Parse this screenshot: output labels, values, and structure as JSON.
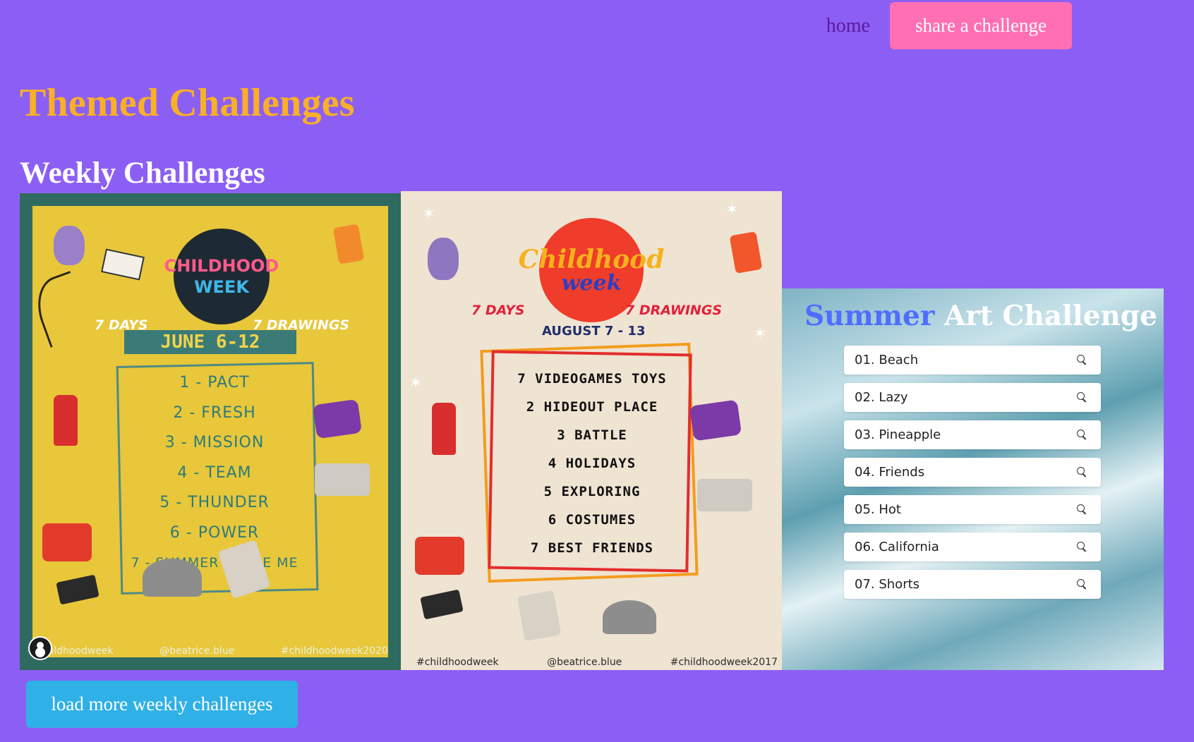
{
  "nav": {
    "home_label": "home",
    "share_label": "share a challenge"
  },
  "page_title": "Themed Challenges",
  "section_title": "Weekly Challenges",
  "cards": [
    {
      "badge_line1": "CHILDHOOD",
      "badge_line2": "WEEK",
      "days": "7 DAYS",
      "drawings": "7 DRAWINGS",
      "date": "JUNE 6-12",
      "items": [
        "1 - PACT",
        "2 - FRESH",
        "3 - MISSION",
        "4 - TEAM",
        "5 - THUNDER",
        "6 - POWER",
        "7 - SUMMER LITTLE ME"
      ],
      "footer_left": "#childhoodweek",
      "footer_center": "@beatrice.blue",
      "footer_right": "#childhoodweek2020"
    },
    {
      "badge_line1": "Childhood",
      "badge_line2": "week",
      "days": "7 DAYS",
      "drawings": "7 DRAWINGS",
      "date": "AUGUST 7 - 13",
      "items": [
        "7 VIDEOGAMES TOYS",
        "2 HIDEOUT PLACE",
        "3 BATTLE",
        "4 HOLIDAYS",
        "5 EXPLORING",
        "6 COSTUMES",
        "7 BEST FRIENDS"
      ],
      "footer_left": "#childhoodweek",
      "footer_center": "@beatrice.blue",
      "footer_right": "#childhoodweek2017"
    },
    {
      "title_word1": "Summer",
      "title_word2": "Art Challenge",
      "items": [
        "01. Beach",
        "02. Lazy",
        "03. Pineapple",
        "04. Friends",
        "05. Hot",
        "06. California",
        "07. Shorts"
      ]
    }
  ],
  "load_more_label": "load more weekly challenges",
  "colors": {
    "background": "#8c5ff4",
    "title": "#f9b026",
    "share_button": "#ff6fb3",
    "load_more_button": "#2fb0e6"
  },
  "icons": [
    "search-icon",
    "user-icon"
  ]
}
